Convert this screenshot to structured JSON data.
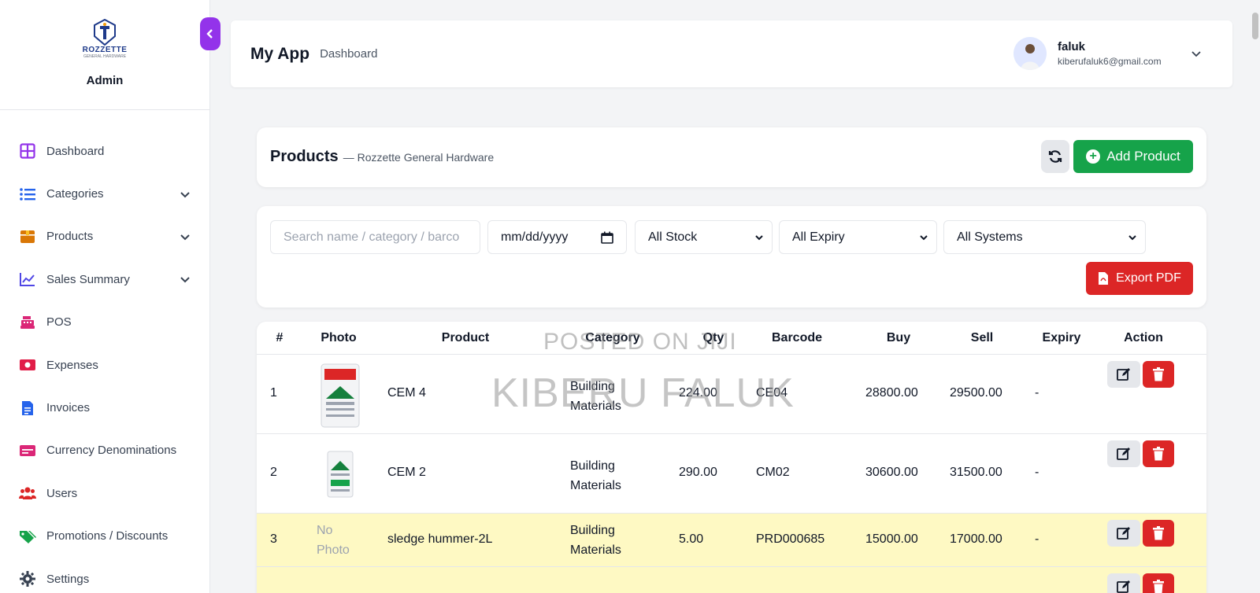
{
  "brand": {
    "logo_text": "ROZZETTE",
    "logo_sub": "GENERAL HARDWARE",
    "role": "Admin"
  },
  "sidebar": {
    "items": [
      {
        "label": "Dashboard",
        "icon": "grid-icon",
        "color": "#9333ea",
        "has_chevron": false
      },
      {
        "label": "Categories",
        "icon": "list-icon",
        "color": "#2563eb",
        "has_chevron": true
      },
      {
        "label": "Products",
        "icon": "box-icon",
        "color": "#d97706",
        "has_chevron": true
      },
      {
        "label": "Sales Summary",
        "icon": "line-chart-icon",
        "color": "#4f46e5",
        "has_chevron": true
      },
      {
        "label": "POS",
        "icon": "cash-register-icon",
        "color": "#db2777",
        "has_chevron": false
      },
      {
        "label": "Expenses",
        "icon": "money-bill-icon",
        "color": "#e11d48",
        "has_chevron": false
      },
      {
        "label": "Invoices",
        "icon": "invoice-icon",
        "color": "#2563eb",
        "has_chevron": false
      },
      {
        "label": "Currency Denominations",
        "icon": "card-icon",
        "color": "#db2777",
        "has_chevron": false
      },
      {
        "label": "Users",
        "icon": "users-icon",
        "color": "#dc2626",
        "has_chevron": false
      },
      {
        "label": "Promotions / Discounts",
        "icon": "tags-icon",
        "color": "#16a34a",
        "has_chevron": false
      },
      {
        "label": "Settings",
        "icon": "gear-icon",
        "color": "#374151",
        "has_chevron": false
      }
    ]
  },
  "header": {
    "app_title": "My App",
    "breadcrumb": "Dashboard",
    "user": {
      "name": "faluk",
      "email": "kiberufaluk6@gmail.com"
    }
  },
  "products_panel": {
    "title": "Products",
    "subtitle": "— Rozzette General Hardware",
    "add_label": "Add Product"
  },
  "filters": {
    "search_placeholder": "Search name / category / barco",
    "date_value": "mm/dd/yyyy",
    "stock_selected": "All Stock",
    "expiry_selected": "All Expiry",
    "systems_selected": "All Systems",
    "export_label": "Export PDF"
  },
  "table": {
    "columns": [
      "#",
      "Photo",
      "Product",
      "Category",
      "Qty",
      "Barcode",
      "Buy",
      "Sell",
      "Expiry",
      "Action"
    ],
    "rows": [
      {
        "num": "1",
        "photo": "image",
        "product": "CEM 4",
        "category_line1": "Building",
        "category_line2": "Materials",
        "qty": "224.00",
        "barcode": "CE04",
        "buy": "28800.00",
        "sell": "29500.00",
        "expiry": "-",
        "highlight": false
      },
      {
        "num": "2",
        "photo": "image",
        "product": "CEM 2",
        "category_line1": "Building",
        "category_line2": "Materials",
        "qty": "290.00",
        "barcode": "CM02",
        "buy": "30600.00",
        "sell": "31500.00",
        "expiry": "-",
        "highlight": false
      },
      {
        "num": "3",
        "photo_line1": "No",
        "photo_line2": "Photo",
        "product": "sledge hummer-2L",
        "category_line1": "Building",
        "category_line2": "Materials",
        "qty": "5.00",
        "barcode": "PRD000685",
        "buy": "15000.00",
        "sell": "17000.00",
        "expiry": "-",
        "highlight": true
      }
    ]
  },
  "watermark": {
    "line1": "POSTED ON JIJI",
    "line2": "KIBERU FALUK"
  },
  "colors": {
    "accent_purple": "#9333ea",
    "success": "#16a34a",
    "danger": "#dc2626",
    "row_highlight": "#fef9c3"
  }
}
